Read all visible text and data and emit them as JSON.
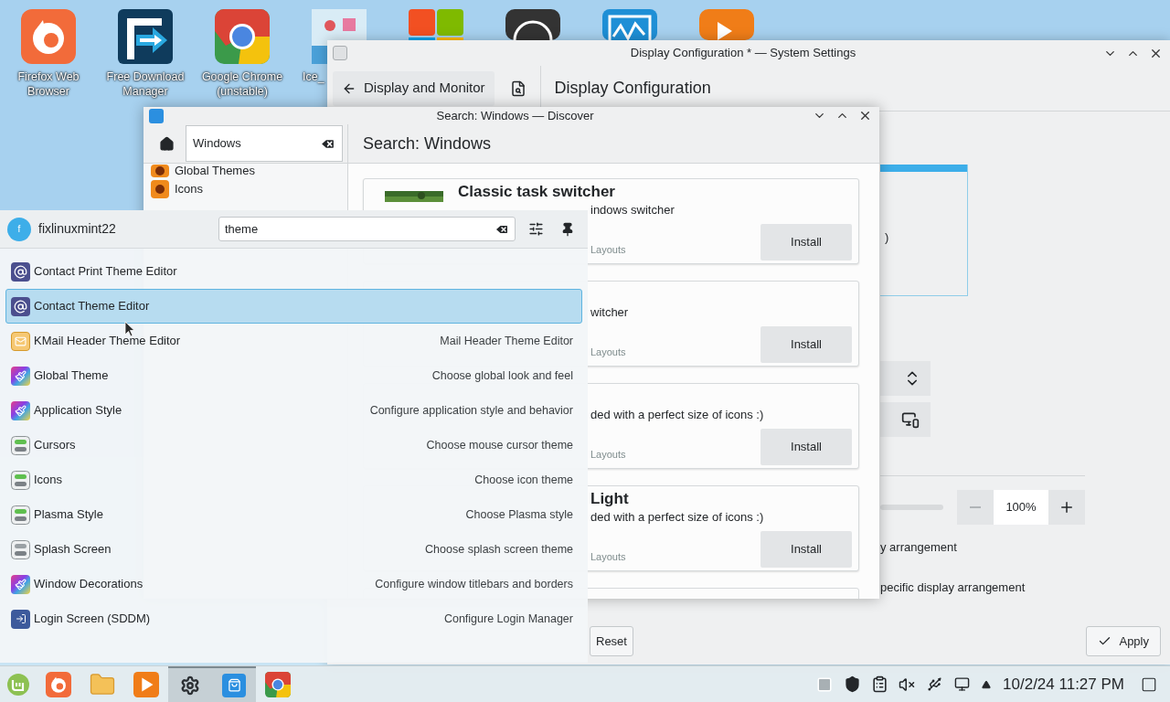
{
  "desktop_icons": [
    {
      "kind": "firefox",
      "label": "Firefox Web Browser"
    },
    {
      "kind": "fdm",
      "label": "Free Download Manager"
    },
    {
      "kind": "chrome",
      "label": "Google Chrome (unstable)"
    },
    {
      "kind": "ice",
      "label": "Ice_"
    },
    {
      "kind": "tiles"
    },
    {
      "kind": "obs"
    },
    {
      "kind": "wave"
    },
    {
      "kind": "play"
    }
  ],
  "settings_window": {
    "title": "Display Configuration * — System Settings",
    "back_button": "Display and Monitor",
    "page_title": "Display Configuration",
    "monitor_label": ")",
    "scale_value": "100%",
    "option_1": "y arrangement",
    "option_2": "pecific display arrangement",
    "reset_button": "Reset",
    "apply_button": "Apply"
  },
  "discover_window": {
    "title": "Search: Windows — Discover",
    "search_value": "Windows",
    "heading": "Search: Windows",
    "sidebar_items": [
      "Global Themes",
      "Icons"
    ],
    "cards": [
      {
        "kind": "with_thumbnail",
        "title": "Classic task switcher",
        "description": "indows switcher",
        "category": "Layouts",
        "button": "Install"
      },
      {
        "kind": "plain",
        "description": "witcher",
        "category": "Layouts",
        "button": "Install"
      },
      {
        "kind": "plain",
        "description": "ded with a perfect size of icons :)",
        "category": "Layouts",
        "button": "Install"
      },
      {
        "kind": "plain",
        "title": "Light",
        "description": "ded with a perfect size of icons :)",
        "category": "Layouts",
        "button": "Install"
      }
    ]
  },
  "launcher": {
    "avatar_letter": "f",
    "user": "fixlinuxmint22",
    "search_value": "theme",
    "items": [
      {
        "kind": "at",
        "name": "Contact Print Theme Editor",
        "selected": false
      },
      {
        "kind": "at",
        "name": "Contact Theme Editor",
        "selected": true
      },
      {
        "kind": "mail",
        "name": "KMail Header Theme Editor",
        "description": "Mail Header Theme Editor",
        "selected": false
      },
      {
        "kind": "brush",
        "name": "Global Theme",
        "description": "Choose global look and feel",
        "selected": false
      },
      {
        "kind": "brush",
        "name": "Application Style",
        "description": "Configure application style and behavior",
        "selected": false
      },
      {
        "kind": "toggle",
        "name": "Cursors",
        "description": "Choose mouse cursor theme",
        "selected": false
      },
      {
        "kind": "toggle",
        "name": "Icons",
        "description": "Choose icon theme",
        "selected": false
      },
      {
        "kind": "toggle",
        "name": "Plasma Style",
        "description": "Choose Plasma style",
        "selected": false
      },
      {
        "kind": "toggle_grey",
        "name": "Splash Screen",
        "description": "Choose splash screen theme",
        "selected": false
      },
      {
        "kind": "brush",
        "name": "Window Decorations",
        "description": "Configure window titlebars and borders",
        "selected": false
      },
      {
        "kind": "login",
        "name": "Login Screen (SDDM)",
        "description": "Configure Login Manager",
        "selected": false
      }
    ]
  },
  "taskbar": {
    "tasks": [
      {
        "kind": "mint",
        "active": false
      },
      {
        "kind": "firefox",
        "active": false
      },
      {
        "kind": "folder",
        "active": false
      },
      {
        "kind": "play",
        "active": false
      },
      {
        "kind": "gear",
        "active": true
      },
      {
        "kind": "discover",
        "active": true
      },
      {
        "kind": "chrome",
        "active": false
      }
    ],
    "clock": "10/2/24 11:27 PM"
  }
}
